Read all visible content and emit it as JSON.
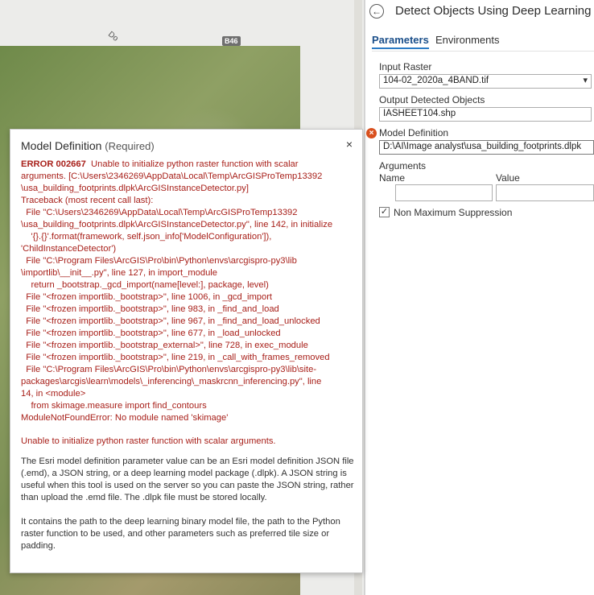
{
  "map": {
    "road_label": "Do",
    "shield_label": "B46"
  },
  "pane": {
    "title": "Detect Objects Using Deep Learning",
    "tabs": [
      "Parameters",
      "Environments"
    ],
    "input_raster": {
      "label": "Input Raster",
      "value": "104-02_2020a_4BAND.tif"
    },
    "output_objects": {
      "label": "Output Detected Objects",
      "value": "IASHEET104.shp"
    },
    "model_definition": {
      "label": "Model Definition",
      "value": "D:\\AI\\Image analyst\\usa_building_footprints.dlpk"
    },
    "arguments": {
      "label": "Arguments",
      "col_name": "Name",
      "col_value": "Value"
    },
    "nms": {
      "label": "Non Maximum Suppression",
      "checked": true
    }
  },
  "popup": {
    "title": "Model Definition",
    "required": "(Required)",
    "close": "×",
    "error_code": "ERROR 002667",
    "error_text": "  Unable to initialize python raster function with scalar\narguments. [C:\\Users\\2346269\\AppData\\Local\\Temp\\ArcGISProTemp13392\n\\usa_building_footprints.dlpk\\ArcGISInstanceDetector.py]\nTraceback (most recent call last):\n  File \"C:\\Users\\2346269\\AppData\\Local\\Temp\\ArcGISProTemp13392\n\\usa_building_footprints.dlpk\\ArcGISInstanceDetector.py\", line 142, in initialize\n    '{}.{}'.format(framework, self.json_info['ModelConfiguration']),\n'ChildInstanceDetector')\n  File \"C:\\Program Files\\ArcGIS\\Pro\\bin\\Python\\envs\\arcgispro-py3\\lib\n\\importlib\\__init__.py\", line 127, in import_module\n    return _bootstrap._gcd_import(name[level:], package, level)\n  File \"<frozen importlib._bootstrap>\", line 1006, in _gcd_import\n  File \"<frozen importlib._bootstrap>\", line 983, in _find_and_load\n  File \"<frozen importlib._bootstrap>\", line 967, in _find_and_load_unlocked\n  File \"<frozen importlib._bootstrap>\", line 677, in _load_unlocked\n  File \"<frozen importlib._bootstrap_external>\", line 728, in exec_module\n  File \"<frozen importlib._bootstrap>\", line 219, in _call_with_frames_removed\n  File \"C:\\Program Files\\ArcGIS\\Pro\\bin\\Python\\envs\\arcgispro-py3\\lib\\site-\npackages\\arcgis\\learn\\models\\_inferencing\\_maskrcnn_inferencing.py\", line\n14, in <module>\n    from skimage.measure import find_contours\nModuleNotFoundError: No module named 'skimage'",
    "summary": "Unable to initialize python raster function with scalar arguments.",
    "description_1": "The Esri model definition parameter value can be an Esri model definition JSON file (.emd), a JSON string, or a deep learning model package (.dlpk). A JSON string is useful when this tool is used on the server so you can paste the JSON string, rather than upload the .emd file. The .dlpk file must be stored locally.",
    "description_2": "It contains the path to the deep learning binary model file, the path to the Python raster function to be used, and other parameters such as preferred tile size or padding."
  }
}
